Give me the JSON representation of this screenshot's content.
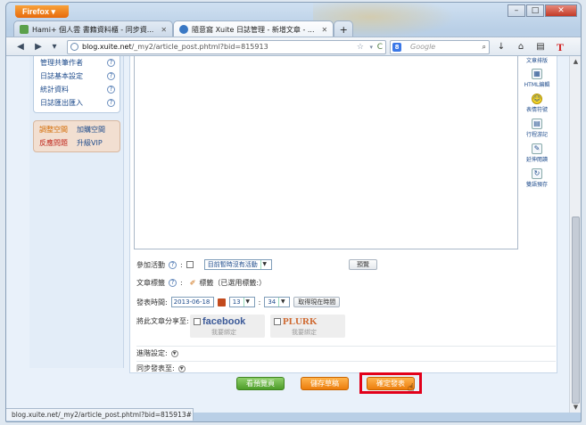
{
  "browser": {
    "app_button": "Firefox",
    "tabs": [
      {
        "label": "Hami+ 個人雲 書籍資料櫃 - 同步資...",
        "active": false
      },
      {
        "label": "隨意窩 Xuite 日誌管理 - 新增文章 - ...",
        "active": true
      }
    ],
    "new_tab": "+",
    "url_host": "blog.xuite.net",
    "url_path": "/_my2/article_post.phtml?bid=815913",
    "search_engine": "8",
    "search_placeholder": "Google",
    "status_text": "blog.xuite.net/_my2/article_post.phtml?bid=815913#"
  },
  "sidebar": {
    "items": [
      {
        "label": "管理共筆作者"
      },
      {
        "label": "日誌基本設定"
      },
      {
        "label": "統計資料"
      },
      {
        "label": "日誌匯出匯入"
      }
    ],
    "space": {
      "adjust": "調整空間",
      "buy": "加購空間",
      "feedback": "反應問題",
      "upgrade": "升級VIP"
    }
  },
  "tools": [
    {
      "label": "文章排版",
      "icon": "layout-icon"
    },
    {
      "label": "HTML編輯",
      "icon": "html-icon"
    },
    {
      "label": "表情符號",
      "icon": "smiley-icon"
    },
    {
      "label": "行程游記",
      "icon": "calendar-icon"
    },
    {
      "label": "延伸閱讀",
      "icon": "edit-icon"
    },
    {
      "label": "雙語預存",
      "icon": "refresh-icon"
    }
  ],
  "form": {
    "activity_label": "參加活動",
    "activity_select": "目前暫時沒有活動",
    "preview_small": "預覽",
    "tags_label": "文章標籤",
    "tags_value": "標籤（已選用標籤:）",
    "publish_time_label": "發表時間:",
    "date": "2013-06-18",
    "hour": "13",
    "minute": "34",
    "now_button": "取得現在時間",
    "share_label": "將此文章分享至:",
    "facebook": "facebook",
    "facebook_sub": "我要綁定",
    "plurk": "PLURK",
    "plurk_sub": "我要綁定",
    "advanced_label": "進階設定:",
    "sync_label": "同步發表至:"
  },
  "buttons": {
    "preview": "看預覽頁",
    "save_draft": "儲存草稿",
    "publish": "確定發表"
  }
}
